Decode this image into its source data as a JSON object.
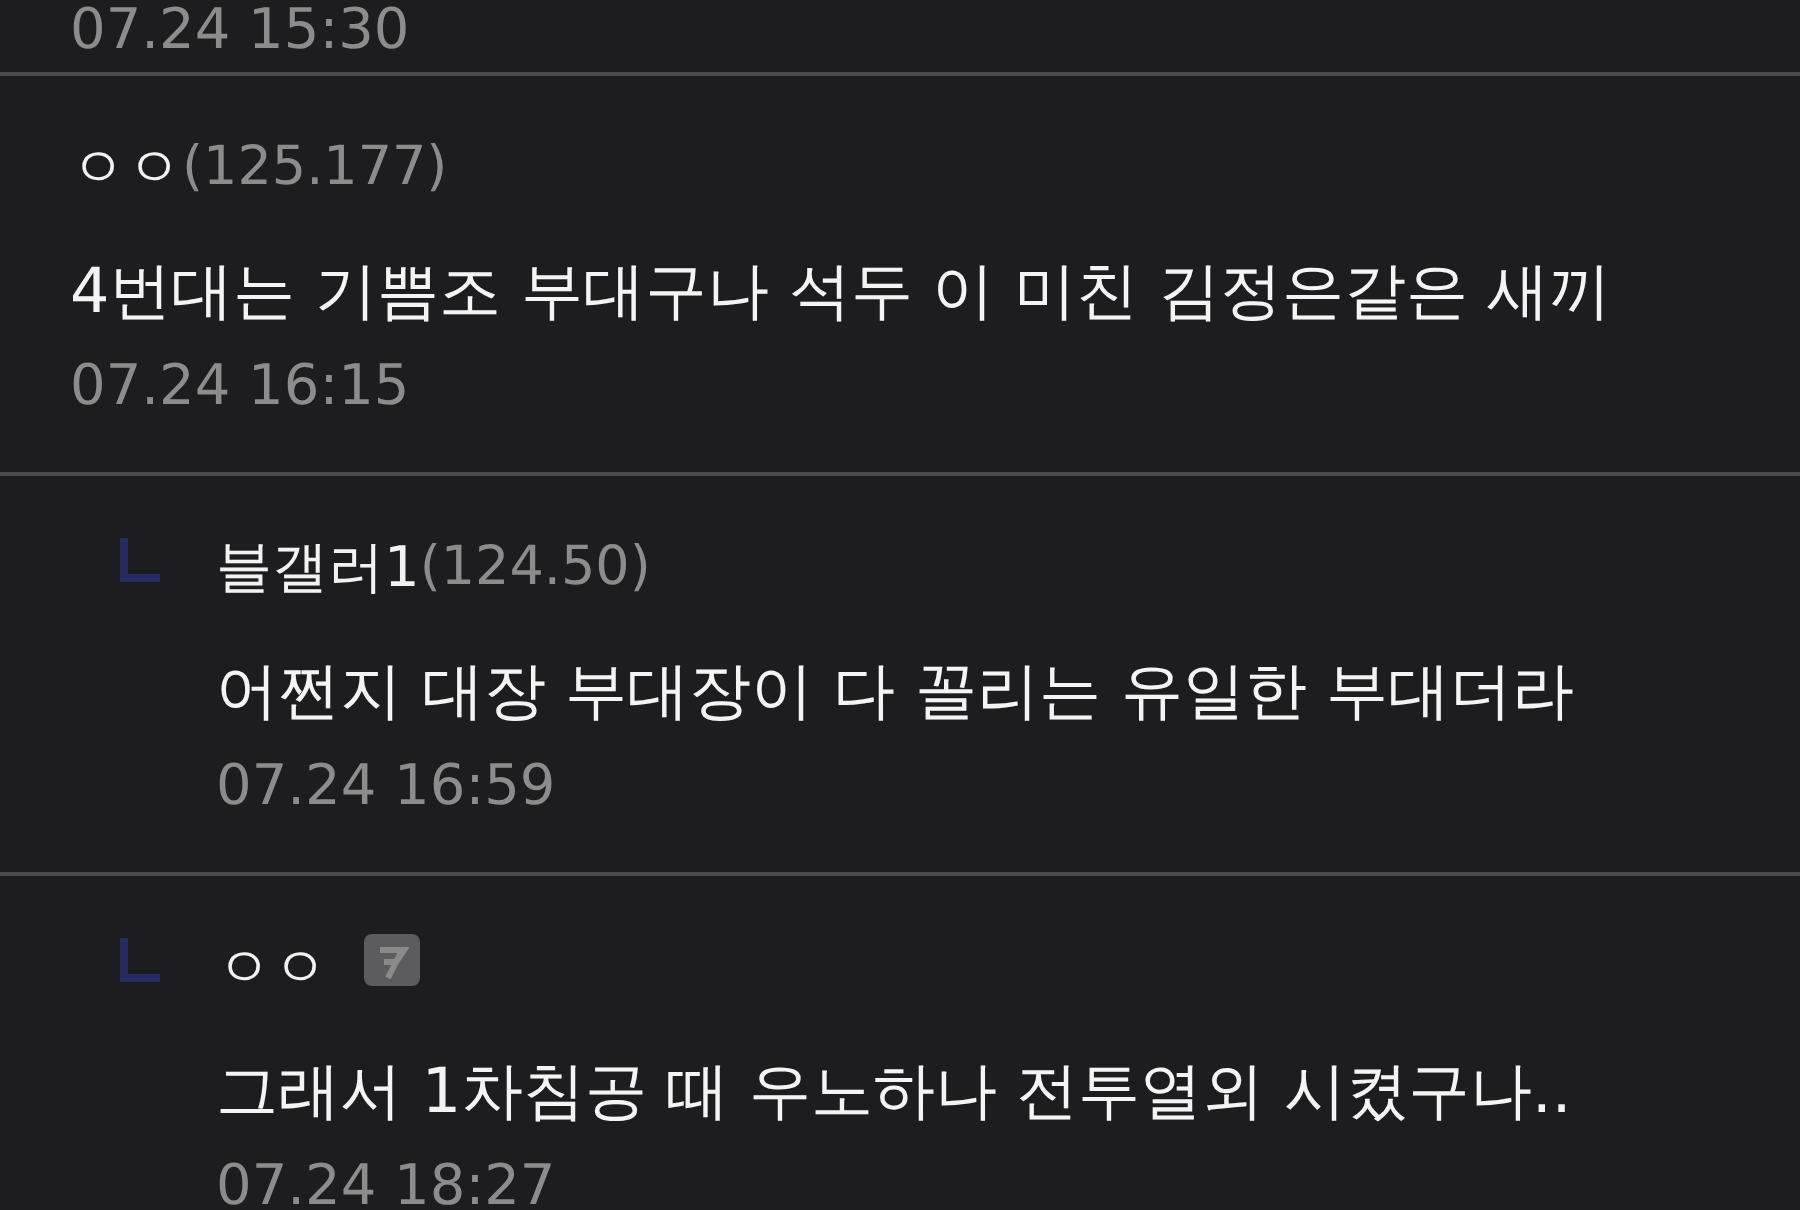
{
  "previous_comment": {
    "time": "07.24 15:30"
  },
  "comments": [
    {
      "kind": "comment",
      "nickname": "ㅇㅇ",
      "ip": "(125.177)",
      "member_badge": false,
      "text": "4번대는 기쁨조 부대구나 석두 이 미친 김정은같은 새끼",
      "time": "07.24 16:15"
    },
    {
      "kind": "reply",
      "nickname": "블갤러1",
      "ip": "(124.50)",
      "member_badge": false,
      "text": "어쩐지 대장 부대장이 다 꼴리는 유일한 부대더라",
      "time": "07.24 16:59"
    },
    {
      "kind": "reply",
      "nickname": "ㅇㅇ",
      "member_badge": true,
      "text": "그래서 1차침공 때 우노하나 전투열외 시켰구나..",
      "time": "07.24 18:27"
    }
  ]
}
